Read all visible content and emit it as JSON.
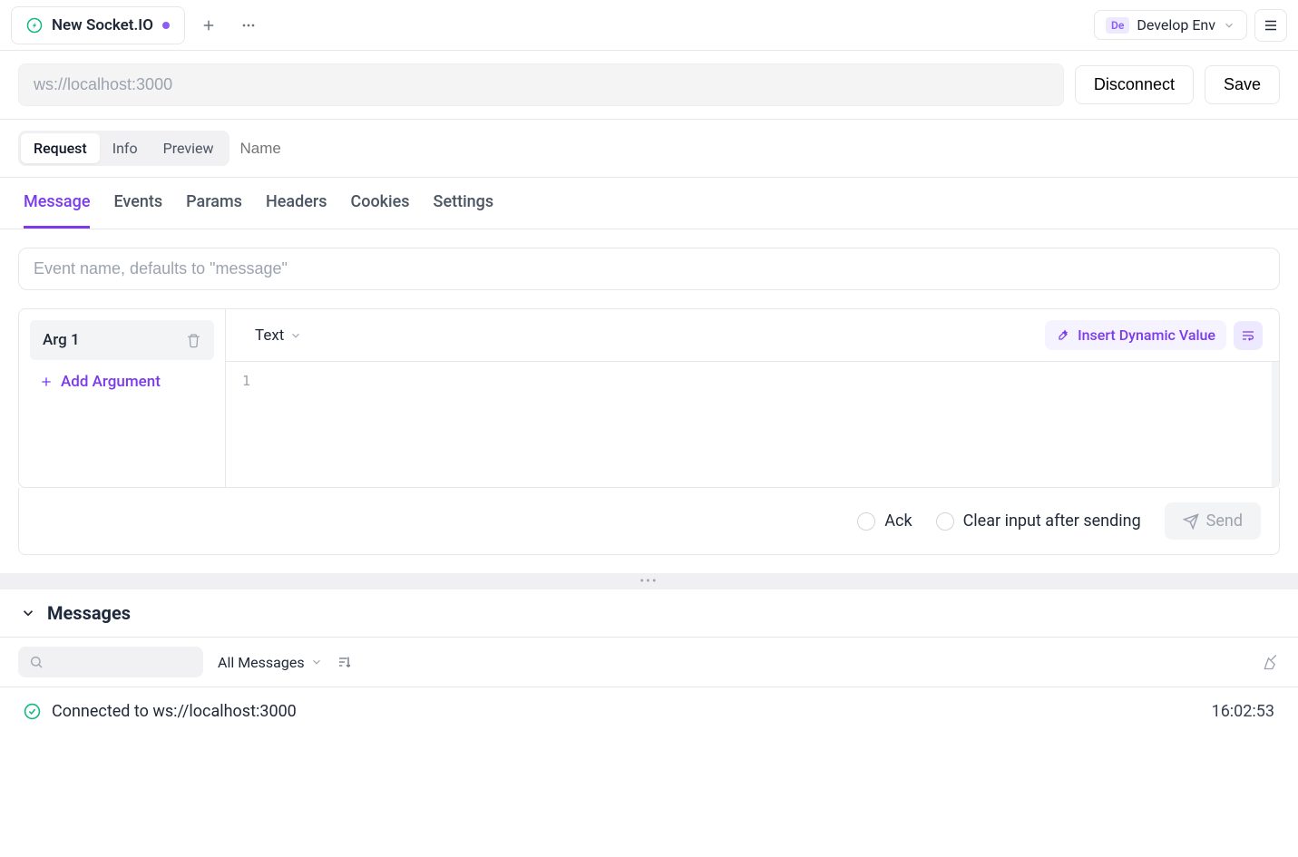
{
  "tab": {
    "title": "New Socket.IO",
    "modified": true
  },
  "env": {
    "badge": "De",
    "label": "Develop Env"
  },
  "url": {
    "value": "ws://localhost:3000"
  },
  "actions": {
    "disconnect": "Disconnect",
    "save": "Save"
  },
  "viewTabs": {
    "request": "Request",
    "info": "Info",
    "preview": "Preview",
    "name_placeholder": "Name"
  },
  "subTabs": [
    "Message",
    "Events",
    "Params",
    "Headers",
    "Cookies",
    "Settings"
  ],
  "activeSubTab": 0,
  "eventName": {
    "placeholder": "Event name, defaults to \"message\""
  },
  "args": {
    "items": [
      "Arg 1"
    ],
    "add_label": "Add Argument"
  },
  "editor": {
    "type_label": "Text",
    "insert_dynamic": "Insert Dynamic Value",
    "line_number": "1",
    "content": ""
  },
  "sendRow": {
    "ack": "Ack",
    "clear": "Clear input after sending",
    "send": "Send"
  },
  "messagesPanel": {
    "title": "Messages",
    "filter_label": "All Messages",
    "log": {
      "text": "Connected to ws://localhost:3000",
      "time": "16:02:53"
    }
  }
}
